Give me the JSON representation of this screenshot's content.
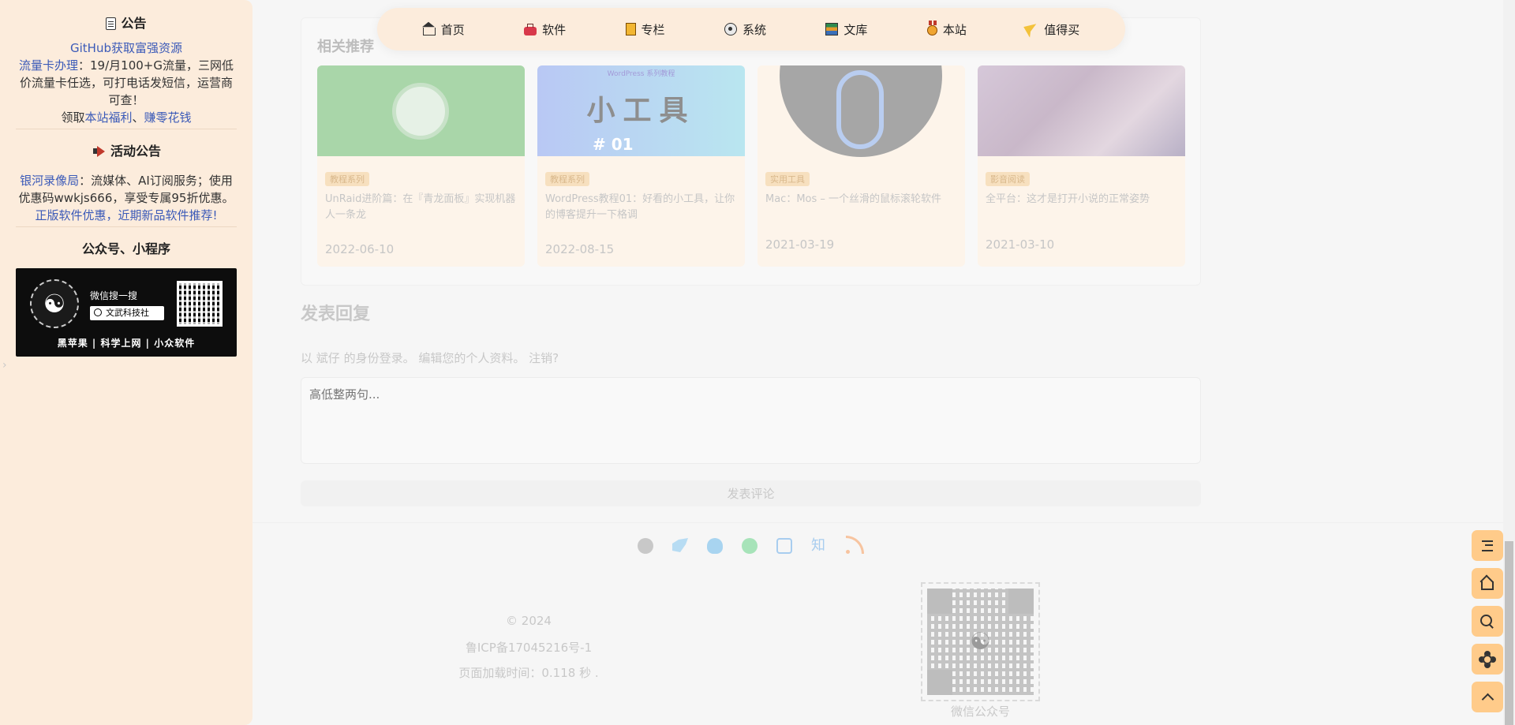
{
  "sidebar": {
    "announcement": {
      "title": "公告",
      "line1_link": "GitHub获取富强资源",
      "line2_link": "流量卡办理",
      "line2_text": "：19/月100+G流量，三网低价流量卡任选，可打电话发短信，运营商可查！",
      "line3_prefix": "领取",
      "line3_link1": "本站福利",
      "line3_sep": "、",
      "line3_link2": "赚零花钱"
    },
    "activity": {
      "title": "活动公告",
      "line1_link": "银河录像局",
      "line1_text": "：流媒体、AI订阅服务；使用优惠码wwkjs666，享受专属95折优惠。",
      "line2_link": "正版软件优惠，近期新品软件推荐!"
    },
    "wechat": {
      "title": "公众号、小程序",
      "banner_search_hint": "微信搜一搜",
      "banner_search_name": "文武科技社",
      "banner_tags": "黑苹果 | 科学上网 | 小众软件"
    }
  },
  "nav": {
    "items": [
      {
        "label": "首页",
        "icon": "home-icon"
      },
      {
        "label": "软件",
        "icon": "toolbox-icon"
      },
      {
        "label": "专栏",
        "icon": "book-icon"
      },
      {
        "label": "系统",
        "icon": "disc-icon"
      },
      {
        "label": "文库",
        "icon": "books-icon"
      },
      {
        "label": "本站",
        "icon": "medal-icon"
      },
      {
        "label": "值得买",
        "icon": "flag-icon"
      }
    ]
  },
  "related": {
    "title": "相关推荐",
    "cards": [
      {
        "tag": "教程系列",
        "title": "UnRaid进阶篇：在『青龙面板』实现机器人一条龙",
        "date": "2022-06-10"
      },
      {
        "tag": "教程系列",
        "title": "WordPress教程01：好看的小工具，让你的博客提升一下格调",
        "date": "2022-08-15",
        "img_text": "小工具",
        "img_badge": "# 01",
        "img_top": "WordPress 系列教程"
      },
      {
        "tag": "实用工具",
        "title": "Mac：Mos – 一个丝滑的鼠标滚轮软件",
        "date": "2021-03-19"
      },
      {
        "tag": "影音阅读",
        "title": "全平台：这才是打开小说的正常姿势",
        "date": "2021-03-10"
      }
    ]
  },
  "reply": {
    "heading": "发表回复",
    "login_prefix": "以 ",
    "login_user": "斌仔",
    "login_mid": " 的身份登录。 ",
    "edit_profile": "编辑您的个人资料",
    "login_sep": "。 ",
    "logout": "注销?",
    "placeholder": "高低整两句...",
    "submit_label": "发表评论"
  },
  "footer": {
    "copyright": "© 2024",
    "icp": "鲁ICP备17045216号-1",
    "load_time": "页面加载时间：0.118 秒 .",
    "qr_caption": "微信公众号"
  },
  "floating": [
    "toc-icon",
    "home-icon",
    "search-icon",
    "theme-icon",
    "back-to-top-icon"
  ],
  "colors": {
    "sidebar_bg": "#fcecdc",
    "link": "#3b5ab8",
    "float_btn": "#ffcb8a"
  }
}
